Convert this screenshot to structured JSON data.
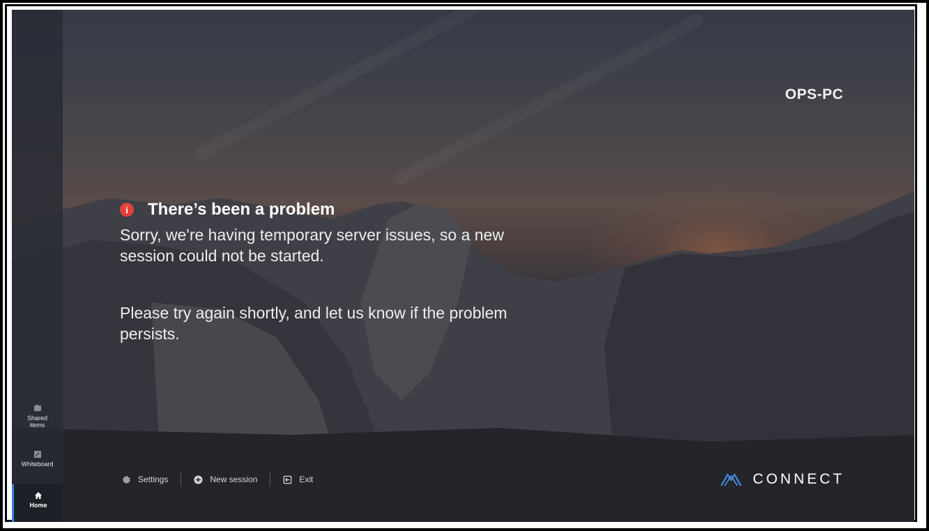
{
  "window": {
    "hostname": "OPS-PC"
  },
  "sidebar": {
    "items": [
      {
        "label": "Shared\nitems",
        "icon": "shared-items-icon"
      },
      {
        "label": "Whiteboard",
        "icon": "whiteboard-icon"
      },
      {
        "label": "Home",
        "icon": "home-icon",
        "active": true
      }
    ]
  },
  "error": {
    "title": "There’s been a problem",
    "icon": "info-alert-icon",
    "message_1": "Sorry, we're having temporary server issues, so a new session could not be started.",
    "message_2": "Please try again shortly, and let us know if the problem persists."
  },
  "footer": {
    "settings_label": "Settings",
    "new_session_label": "New session",
    "exit_label": "Exit"
  },
  "brand": {
    "name": "CONNECT",
    "accent_color": "#3e82e0"
  },
  "colors": {
    "error": "#e0423a",
    "active_indicator": "#3e82e0"
  }
}
